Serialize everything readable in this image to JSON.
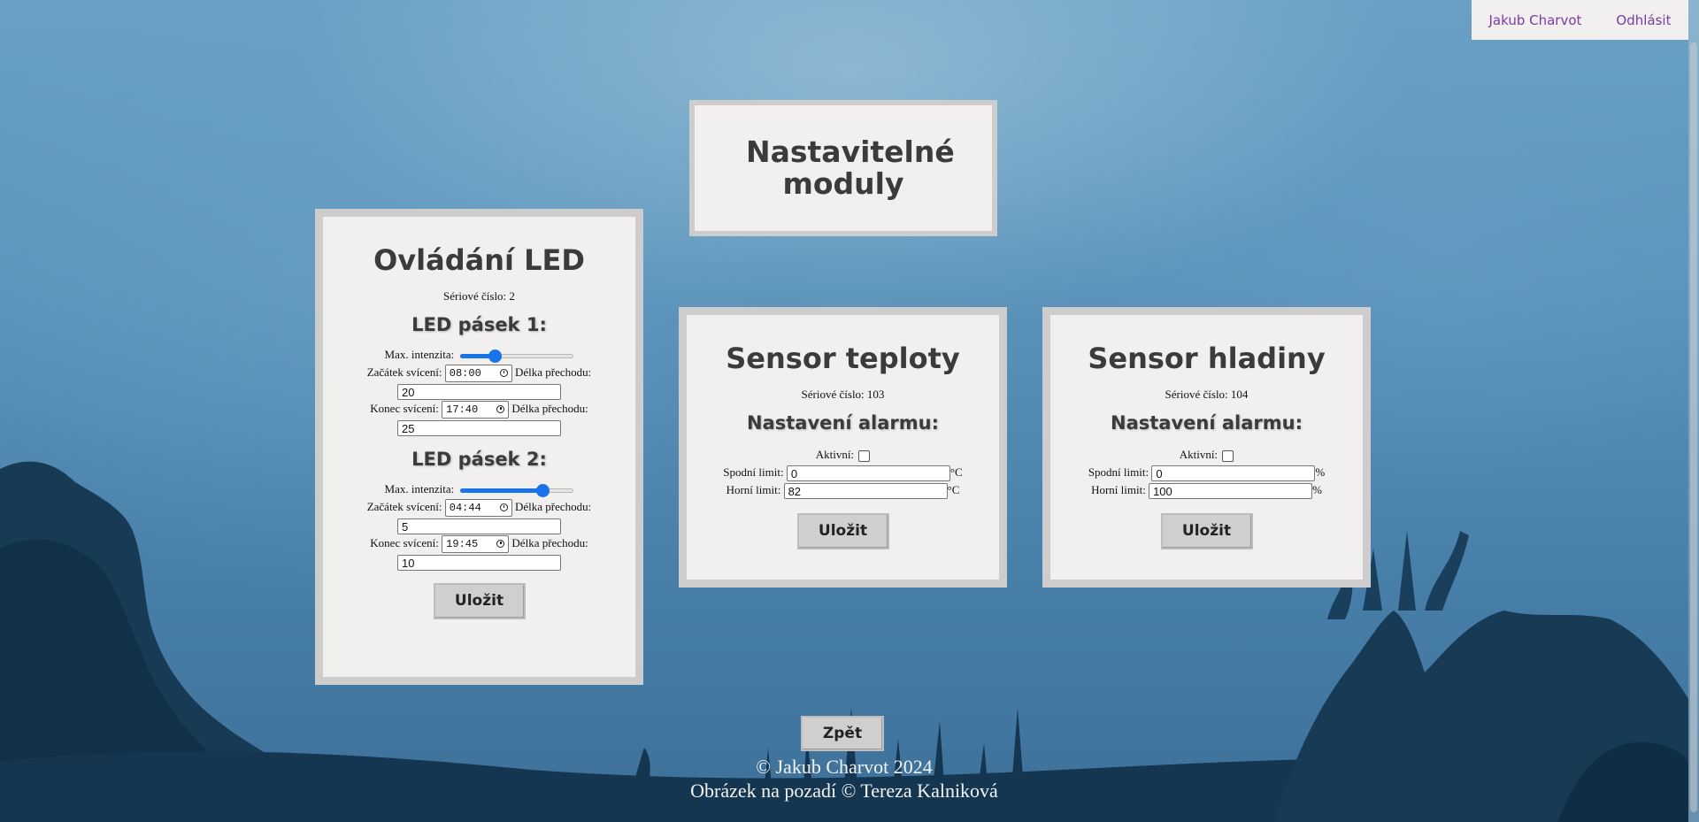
{
  "nav": {
    "user": "Jakub Charvot",
    "logout": "Odhlásit"
  },
  "page_title": "Nastavitelné moduly",
  "led": {
    "title": "Ovládání LED",
    "serial": "Sériové číslo: 2",
    "strip1": {
      "title": "LED pásek 1:",
      "intensity_label": "Max. intenzita:",
      "intensity": 0.3,
      "start_label": "Začátek svícení:",
      "start_time": "08:00",
      "start_transition_label": "Délka přechodu:",
      "start_transition": "20",
      "end_label": "Konec svícení:",
      "end_time": "17:40",
      "end_transition_label": "Délka přechodu:",
      "end_transition": "25"
    },
    "strip2": {
      "title": "LED pásek 2:",
      "intensity_label": "Max. intenzita:",
      "intensity": 0.72,
      "start_label": "Začátek svícení:",
      "start_time": "04:44",
      "start_transition_label": "Délka přechodu:",
      "start_transition": "5",
      "end_label": "Konec svícení:",
      "end_time": "19:45",
      "end_transition_label": "Délka přechodu:",
      "end_transition": "10"
    },
    "save": "Uložit"
  },
  "temp": {
    "title": "Sensor teploty",
    "serial": "Sériové číslo: 103",
    "alarm_title": "Nastavení alarmu:",
    "active_label": "Aktivní:",
    "active": false,
    "low_label": "Spodní limit:",
    "low_value": "0",
    "low_unit": "°C",
    "high_label": "Horní limit:",
    "high_value": "82",
    "high_unit": "°C",
    "save": "Uložit"
  },
  "level": {
    "title": "Sensor hladiny",
    "serial": "Sériové číslo: 104",
    "alarm_title": "Nastavení alarmu:",
    "active_label": "Aktivní:",
    "active": false,
    "low_label": "Spodní limit:",
    "low_value": "0",
    "low_unit": "%",
    "high_label": "Horní limit:",
    "high_value": "100",
    "high_unit": "%",
    "save": "Uložit"
  },
  "back": "Zpět",
  "footer": {
    "copyright": "© Jakub Charvot 2024",
    "image_credit": "Obrázek na pozadí © Tereza Kalniková"
  },
  "colors": {
    "panel_bg": "#f1f0ee",
    "panel_border": "#cdcdcd",
    "nav_link": "#7a3aa6",
    "slider_accent": "#1a73e8",
    "water": "#5b93b9"
  }
}
